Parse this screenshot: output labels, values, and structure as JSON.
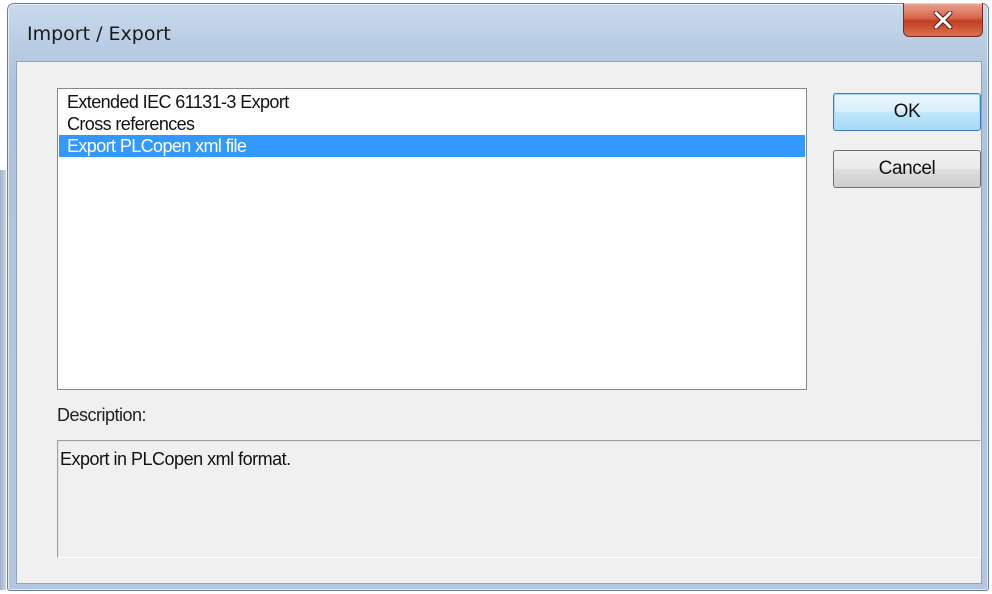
{
  "window": {
    "title": "Import / Export"
  },
  "list": {
    "items": [
      {
        "label": "Extended IEC 61131-3 Export",
        "selected": false
      },
      {
        "label": "Cross references",
        "selected": false
      },
      {
        "label": "Export PLCopen xml file",
        "selected": true
      }
    ]
  },
  "buttons": {
    "ok_label": "OK",
    "cancel_label": "Cancel"
  },
  "description": {
    "label": "Description:",
    "text": "Export in PLCopen xml format."
  },
  "colors": {
    "selection": "#3399ff",
    "close_button": "#c94a2e",
    "dialog_face": "#f0f0f0"
  },
  "icons": {
    "close": "close-icon"
  }
}
